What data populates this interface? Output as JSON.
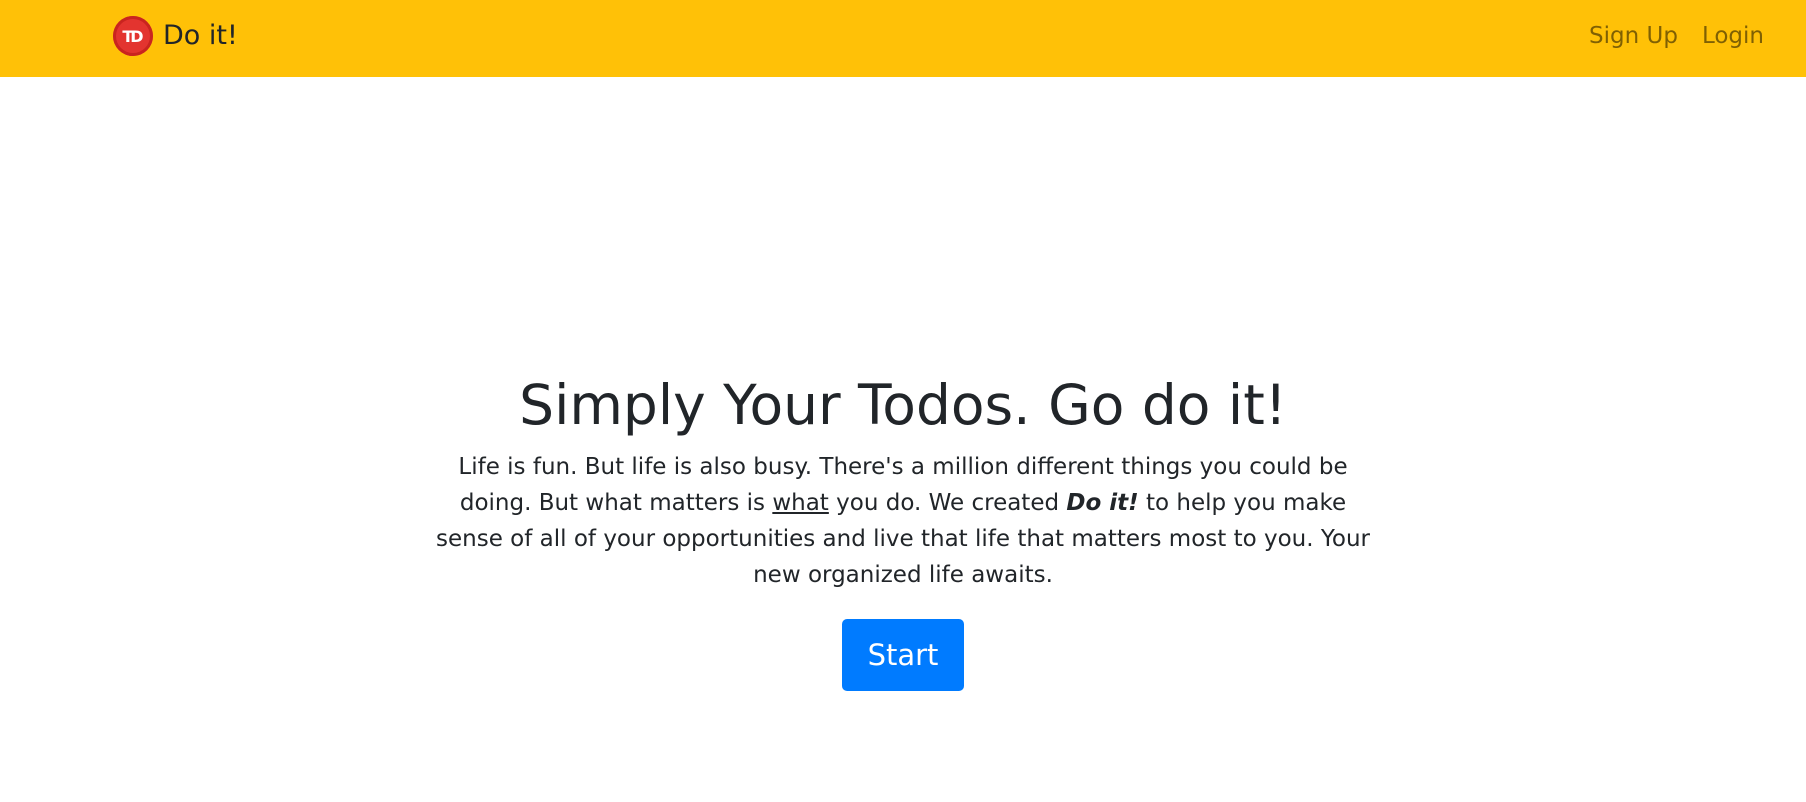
{
  "navbar": {
    "brand": {
      "logo_text": "TD",
      "logo_icon": "todo-logo-icon",
      "name": "Do it!"
    },
    "links": {
      "signup": "Sign Up",
      "login": "Login"
    },
    "background_color": "#ffc107"
  },
  "hero": {
    "title": "Simply Your Todos. Go do it!",
    "text": {
      "part1": "Life is fun. But life is also busy. There's a million different things you could be doing. But what matters is ",
      "underlined": "what",
      "part2": " you do. We created ",
      "emphasis": "Do it!",
      "part3": " to help you make sense of all of your opportunities and live that life that matters most to you. Your new organized life awaits."
    },
    "button": {
      "label": "Start",
      "color": "#007bff"
    }
  }
}
